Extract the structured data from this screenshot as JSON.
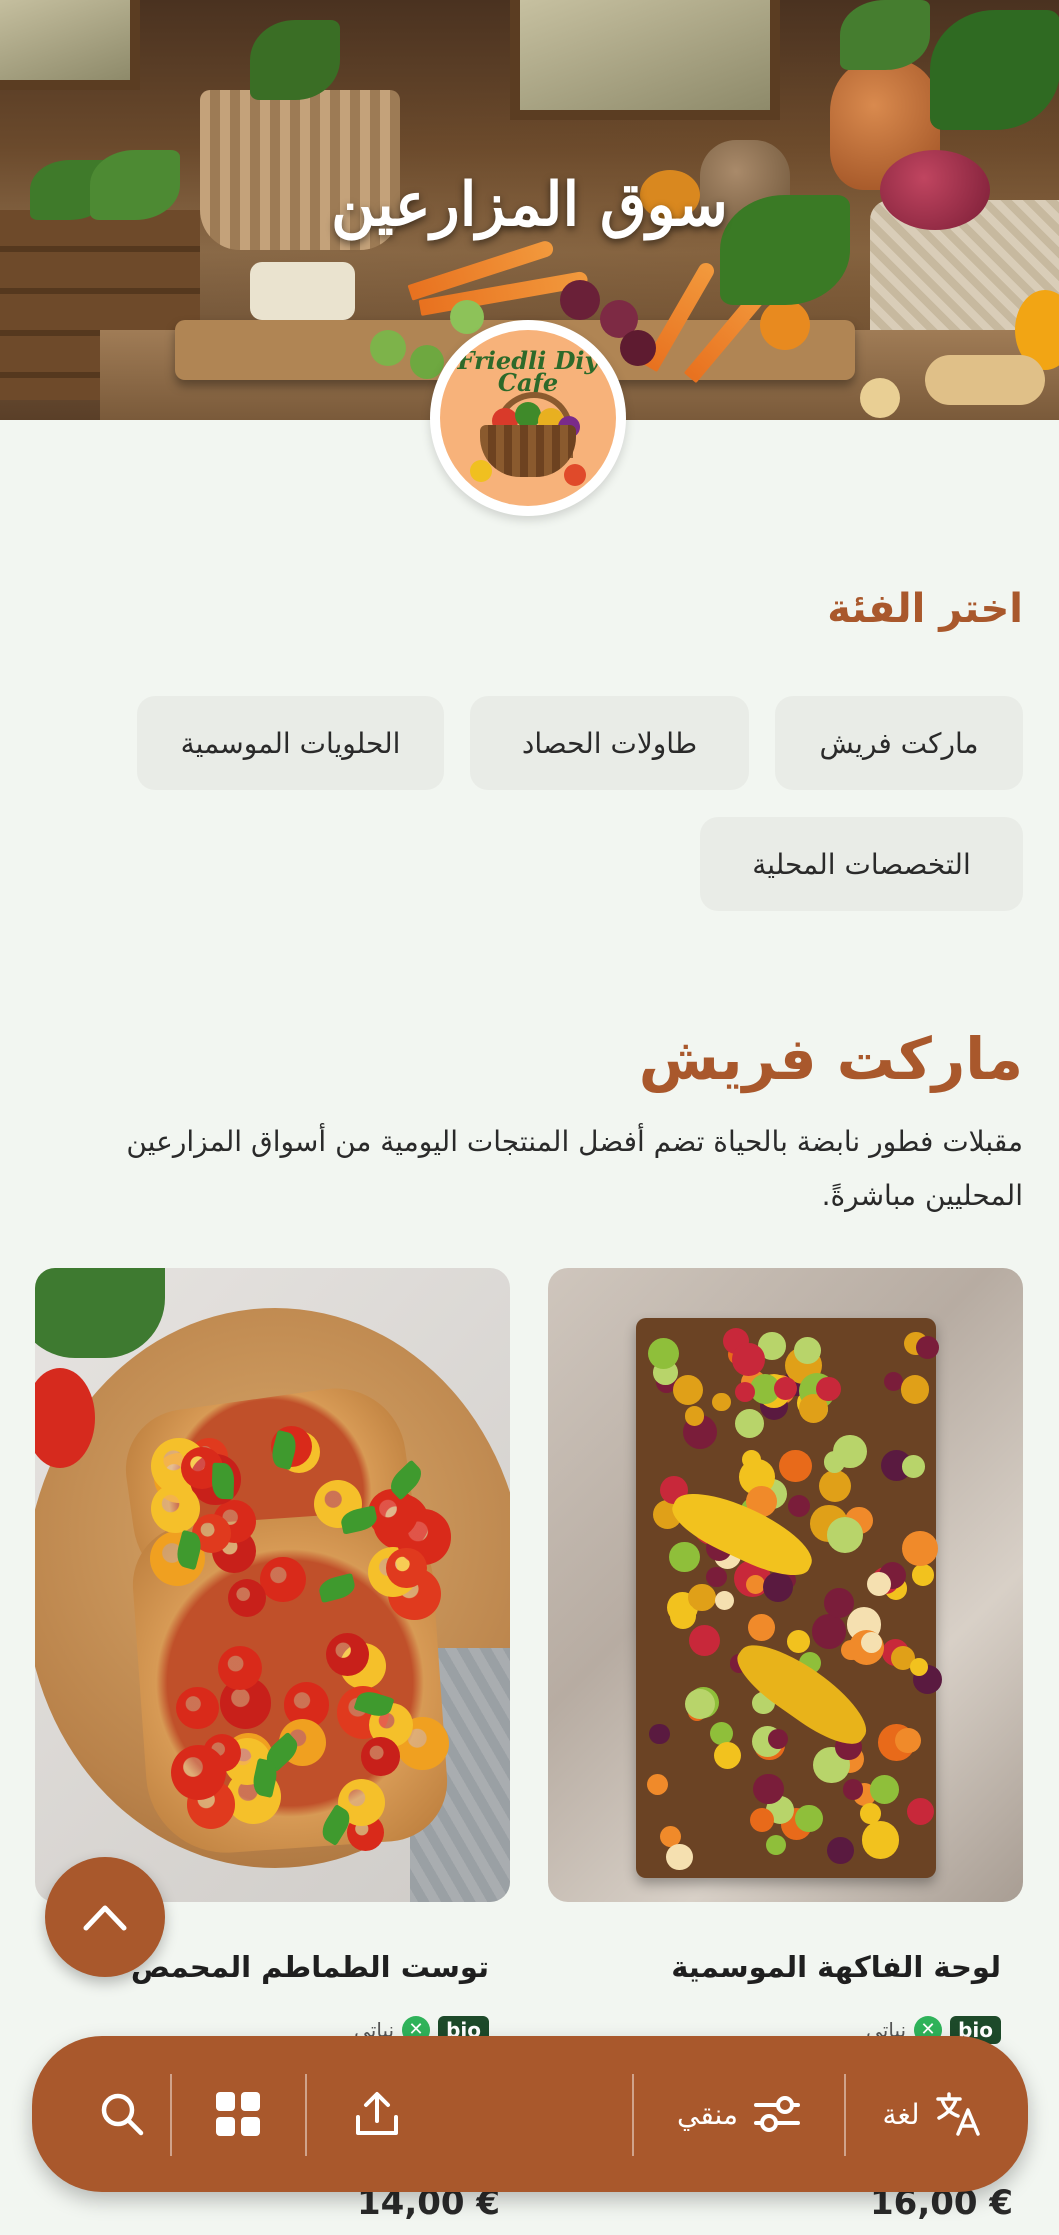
{
  "hero": {
    "title": "سوق المزارعين",
    "logo_text_line1": "Friedli Diy",
    "logo_text_line2": "Cafe"
  },
  "category": {
    "heading": "اختر الفئة",
    "chips": [
      "ماركت فريش",
      "طاولات الحصاد",
      "الحلويات الموسمية",
      "التخصصات المحلية"
    ]
  },
  "section": {
    "title": "ماركت فريش",
    "description": "مقبلات فطور نابضة بالحياة تضم أفضل المنتجات اليومية من أسواق المزارعين المحليين مباشرةً."
  },
  "products": [
    {
      "name": "لوحة الفاكهة الموسمية",
      "badge": "bio",
      "diet": "نباتي",
      "price": "16,00 €"
    },
    {
      "name": "توست الطماطم المحمص",
      "badge": "bio",
      "diet": "نباتي",
      "price": "14,00 €"
    }
  ],
  "nav": {
    "language_label": "لغة",
    "filter_label": "منقي"
  },
  "colors": {
    "accent": "#a9582c",
    "background": "#f2f6f1",
    "chip": "#e9ece7",
    "bio_badge": "#1d4a2a",
    "veg_badge": "#2fb35a"
  },
  "icons": [
    "chevron-up-icon",
    "search-icon",
    "grid-icon",
    "share-icon",
    "filter-icon",
    "translate-icon"
  ]
}
